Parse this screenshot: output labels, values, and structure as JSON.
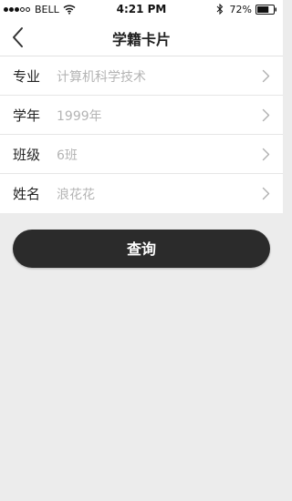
{
  "status_bar": {
    "carrier": "BELL",
    "time": "4:21 PM",
    "battery_percent": "72%",
    "battery_level": 0.72,
    "signal_bars_filled": 3,
    "signal_bars_total": 5,
    "icons": [
      "wifi-icon",
      "bluetooth-icon",
      "battery-icon"
    ]
  },
  "nav": {
    "title": "学籍卡片",
    "back_icon": "chevron-left-icon"
  },
  "form": {
    "rows": [
      {
        "label": "专业",
        "value": "计算机科学技术"
      },
      {
        "label": "学年",
        "value": "1999年"
      },
      {
        "label": "班级",
        "value": "6班"
      },
      {
        "label": "姓名",
        "value": "浪花花"
      }
    ],
    "row_icon": "chevron-right-icon"
  },
  "actions": {
    "query_label": "查询"
  },
  "colors": {
    "page_background": "#ececec",
    "button_background": "#2b2b2b",
    "placeholder_text": "#b4b4b4"
  }
}
